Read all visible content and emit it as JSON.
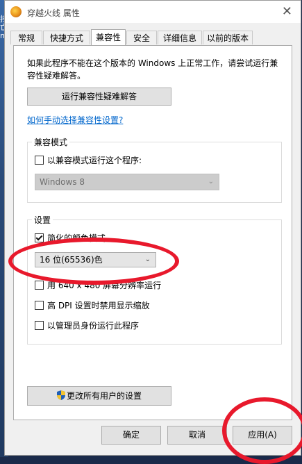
{
  "window": {
    "title": "穿越火线 属性",
    "close_glyph": "✕"
  },
  "desktop": {
    "chars": [
      "挡",
      "亡",
      "ne"
    ]
  },
  "tabs": [
    {
      "label": "常规",
      "active": false
    },
    {
      "label": "快捷方式",
      "active": false
    },
    {
      "label": "兼容性",
      "active": true
    },
    {
      "label": "安全",
      "active": false
    },
    {
      "label": "详细信息",
      "active": false
    },
    {
      "label": "以前的版本",
      "active": false
    }
  ],
  "compat": {
    "intro": "如果此程序不能在这个版本的 Windows 上正常工作，请尝试运行兼容性疑难解答。",
    "troubleshoot_button": "运行兼容性疑难解答",
    "manual_link": "如何手动选择兼容性设置?",
    "mode_group": {
      "label": "兼容模式",
      "checkbox_label": "以兼容模式运行这个程序:",
      "checked": false,
      "os_select": "Windows 8"
    },
    "settings_group": {
      "label": "设置",
      "reduced_color": {
        "label": "简化的颜色模式",
        "checked": true
      },
      "color_select": "16 位(65536)色",
      "resolution": {
        "label": "用 640 x 480 屏幕分辨率运行",
        "checked": false
      },
      "dpi": {
        "label": "高 DPI 设置时禁用显示缩放",
        "checked": false
      },
      "admin": {
        "label": "以管理员身份运行此程序",
        "checked": false
      }
    },
    "all_users_button": "更改所有用户的设置"
  },
  "footer": {
    "ok": "确定",
    "cancel": "取消",
    "apply": "应用(A)"
  },
  "colors": {
    "link": "#0066cc",
    "annotation": "#e8192c",
    "panel": "#ffffff",
    "dialog": "#f0f0f0"
  },
  "icons": {
    "app": "crossfire-app-icon",
    "close": "close-icon",
    "shield": "uac-shield-icon",
    "chevron": "chevron-down-icon"
  }
}
